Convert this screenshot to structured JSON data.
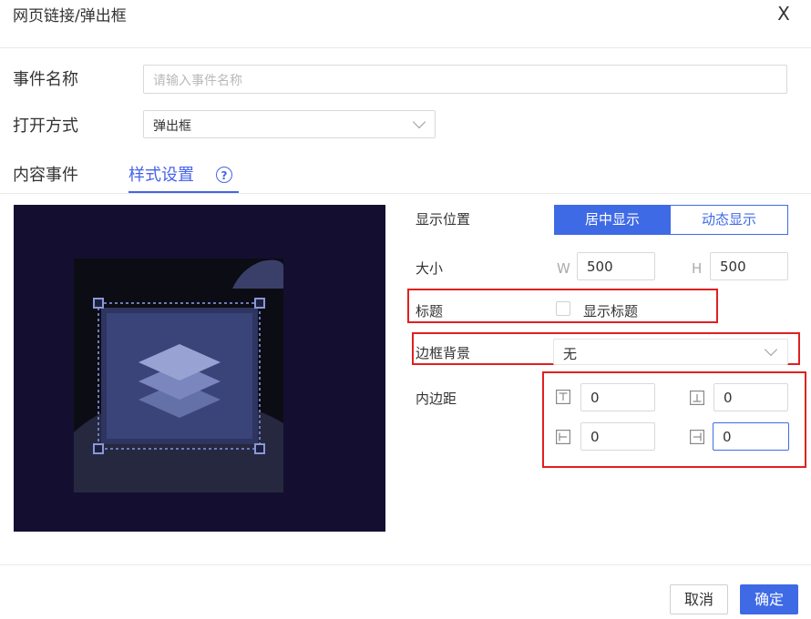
{
  "dialog": {
    "title": "网页链接/弹出框",
    "close_label": "X"
  },
  "form": {
    "event_name_label": "事件名称",
    "event_name_placeholder": "请输入事件名称",
    "event_name_value": "",
    "open_mode_label": "打开方式",
    "open_mode_value": "弹出框"
  },
  "tabs": [
    {
      "label": "内容事件",
      "active": false
    },
    {
      "label": "样式设置",
      "active": true,
      "help": "?"
    }
  ],
  "props": {
    "position_label": "显示位置",
    "position_options": [
      "居中显示",
      "动态显示"
    ],
    "position_selected": "居中显示",
    "size_label": "大小",
    "width_unit": "W",
    "width_value": "500",
    "height_unit": "H",
    "height_value": "500",
    "title_label": "标题",
    "show_title_label": "显示标题",
    "show_title_checked": false,
    "border_bg_label": "边框背景",
    "border_bg_value": "无",
    "padding_label": "内边距",
    "padding_top": "0",
    "padding_bottom": "0",
    "padding_left": "0",
    "padding_right": "0"
  },
  "footer": {
    "cancel": "取消",
    "ok": "确定"
  },
  "colors": {
    "accent": "#3f6ae6",
    "highlight": "#e02020",
    "preview_bg": "#140f30"
  }
}
